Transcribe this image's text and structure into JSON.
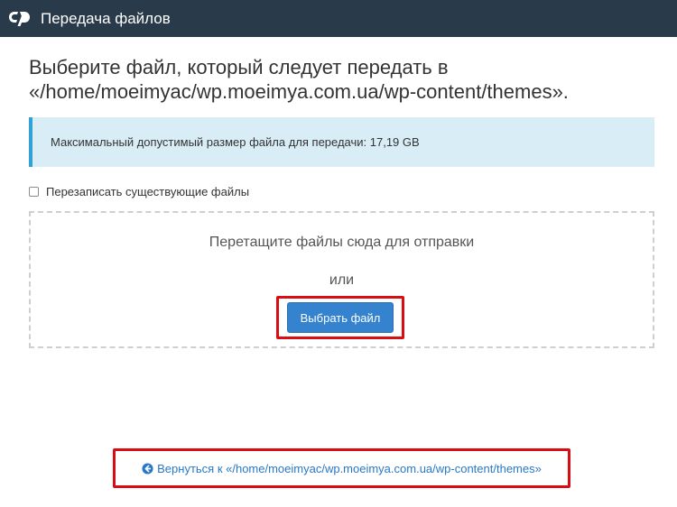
{
  "header": {
    "logo_text": "cP",
    "title": "Передача файлов"
  },
  "main": {
    "heading": "Выберите файл, который следует передать в «/home/moeimyac/wp.moeimya.com.ua/wp-content/themes».",
    "alert_text": "Максимальный допустимый размер файла для передачи: 17,19 GB",
    "overwrite_label": "Перезаписать существующие файлы",
    "overwrite_checked": false,
    "dropzone": {
      "drop_text": "Перетащите файлы сюда для отправки",
      "or_text": "или",
      "choose_label": "Выбрать файл"
    },
    "back_link": "Вернуться к «/home/moeimyac/wp.moeimya.com.ua/wp-content/themes»"
  },
  "colors": {
    "header_bg": "#293a4a",
    "alert_bg": "#d9edf7",
    "alert_border": "#31a2d6",
    "button_bg": "#3583ce",
    "link": "#2878c8",
    "highlight": "#d90e14"
  },
  "icons": {
    "back": "arrow-circle-left-icon"
  }
}
